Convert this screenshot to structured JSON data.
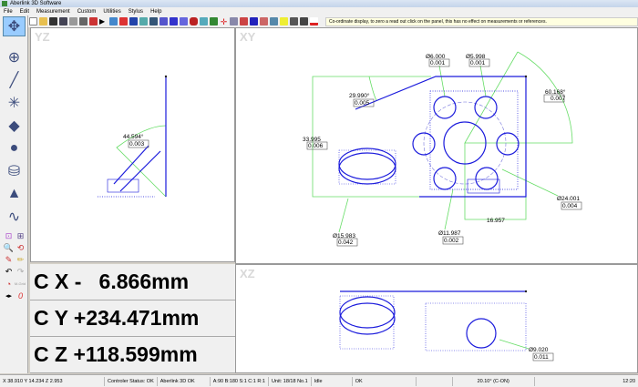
{
  "window": {
    "title": "Aberlink 3D Software"
  },
  "menu": [
    "File",
    "Edit",
    "Measurement",
    "Custom",
    "Utilities",
    "Stylus",
    "Help"
  ],
  "toolbar": {
    "hint": "Co-ordinate display, to zero a read out click on the panel, this has no effect on measurements or references."
  },
  "left_toolbar": {
    "mode_label": "M-Grid",
    "counter": "0"
  },
  "views": {
    "yz": "YZ",
    "xy": "XY",
    "xz": "XZ"
  },
  "readout": {
    "x": "C X -   6.866mm",
    "y": "C Y +234.471mm",
    "z": "C Z +118.599mm"
  },
  "annotations": {
    "yz_angle": "44.594°",
    "yz_angle_tol": "0.003",
    "xy_d1": "Ø6.000",
    "xy_d1_tol": "0.001",
    "xy_d2": "Ø5.998",
    "xy_d2_tol": "0.001",
    "xy_angle1": "29.990°",
    "xy_angle1_tol": "0.005",
    "xy_angle2": "60.168°",
    "xy_angle2_tol": "0.007",
    "xy_dist": "33.995",
    "xy_dist_tol": "0.006",
    "xy_d3": "Ø24.001",
    "xy_d3_tol": "0.004",
    "xy_len": "16.957",
    "xy_d4": "Ø15.983",
    "xy_d4_tol": "0.042",
    "xy_d5": "Ø11.987",
    "xy_d5_tol": "0.002",
    "xz_d1": "Ø9.020",
    "xz_d1_tol": "0.011"
  },
  "status": {
    "coords": "X 38.910 Y 14.234 Z 2.953",
    "controller": "Controler Status: OK",
    "software": "Aberlink 3D OK",
    "angles": "A:90  B:180  S:1  C:1  R:1",
    "unit": "Unit: 18/18 No.1",
    "state": "Idle",
    "ok": "OK",
    "temp": "20.10° (C-ON)",
    "time": "12:20"
  },
  "colors": {
    "geometry": "#1a1adc",
    "dimension": "#66dd66"
  }
}
